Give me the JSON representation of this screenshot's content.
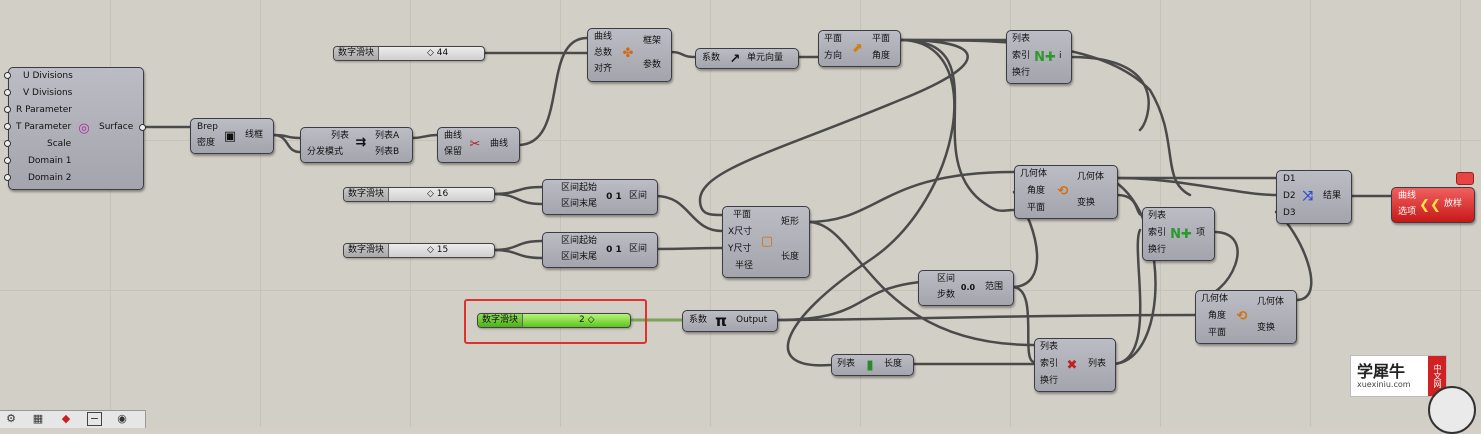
{
  "surface_comp": {
    "inputs": [
      "U Divisions",
      "V Divisions",
      "R Parameter",
      "T Parameter",
      "Scale",
      "Domain 1",
      "Domain 2"
    ],
    "output": "Surface"
  },
  "wireframe_comp": {
    "inputs": [
      "Brep",
      "密度"
    ],
    "output": "线框"
  },
  "dispatch_comp": {
    "inputs": [
      "列表",
      "分发模式"
    ],
    "outputs": [
      "列表A",
      "列表B"
    ]
  },
  "cull_comp": {
    "inputs": [
      "曲线",
      "保留"
    ],
    "output": "曲线"
  },
  "slider_44": {
    "name": "数字滑块",
    "value": "44"
  },
  "slider_16": {
    "name": "数字滑块",
    "value": "16"
  },
  "slider_15": {
    "name": "数字滑块",
    "value": "15"
  },
  "slider_2": {
    "name": "数字滑块",
    "value": "2"
  },
  "frames_comp": {
    "inputs": [
      "曲线",
      "总数",
      "对齐"
    ],
    "outputs": [
      "框架",
      "参数"
    ]
  },
  "unitz_comp": {
    "input": "系数",
    "output": "单元向量"
  },
  "plane_comp": {
    "inputs": [
      "平面",
      "方向"
    ],
    "outputs": [
      "平面",
      "角度"
    ]
  },
  "list_item_top": {
    "inputs": [
      "列表",
      "索引",
      "换行"
    ],
    "output": "i"
  },
  "domain1_comp": {
    "inputs": [
      "区间起始",
      "区间末尾"
    ],
    "output": "区间"
  },
  "domain2_comp": {
    "inputs": [
      "区间起始",
      "区间末尾"
    ],
    "output": "区间"
  },
  "rect_comp": {
    "inputs": [
      "平面",
      "X尺寸",
      "Y尺寸",
      "半径"
    ],
    "outputs": [
      "矩形",
      "长度"
    ]
  },
  "pi_comp": {
    "input": "系数",
    "output": "Output"
  },
  "range_comp": {
    "inputs": [
      "区间",
      "步数"
    ],
    "output": "范围"
  },
  "list_length_comp": {
    "input": "列表",
    "output": "长度"
  },
  "list_shift_comp": {
    "inputs": [
      "列表",
      "索引",
      "换行"
    ],
    "output": "列表"
  },
  "rotate_top": {
    "inputs": [
      "几何体",
      "角度",
      "平面"
    ],
    "outputs": [
      "几何体",
      "变换"
    ]
  },
  "list_item_mid": {
    "inputs": [
      "列表",
      "索引",
      "换行"
    ],
    "output": "项"
  },
  "rotate_bottom": {
    "inputs": [
      "几何体",
      "角度",
      "平面"
    ],
    "outputs": [
      "几何体",
      "变换"
    ]
  },
  "weave_comp": {
    "inputs": [
      "D1",
      "D2",
      "D3"
    ],
    "output": "结果"
  },
  "loft_comp": {
    "inputs": [
      "曲线",
      "选项"
    ],
    "output": "放样"
  },
  "logo": {
    "main": "学犀牛",
    "url": "xuexiniu.com",
    "tag": "中文网"
  }
}
